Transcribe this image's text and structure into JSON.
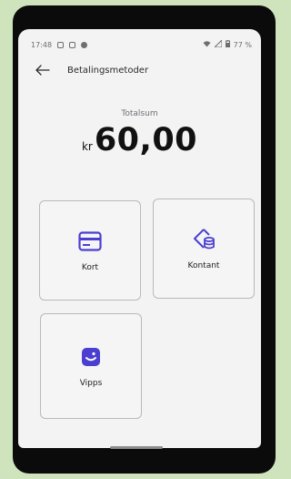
{
  "status_bar": {
    "time": "17:48",
    "battery": "77 %"
  },
  "header": {
    "title": "Betalingsmetoder"
  },
  "total": {
    "label": "Totalsum",
    "currency": "kr",
    "amount": "60,00"
  },
  "payment_methods": [
    {
      "label": "Kort",
      "icon": "card-icon"
    },
    {
      "label": "Kontant",
      "icon": "cash-icon"
    },
    {
      "label": "Vipps",
      "icon": "vipps-icon"
    }
  ],
  "colors": {
    "accent": "#4a3fd1",
    "background": "#f3f3f4"
  }
}
